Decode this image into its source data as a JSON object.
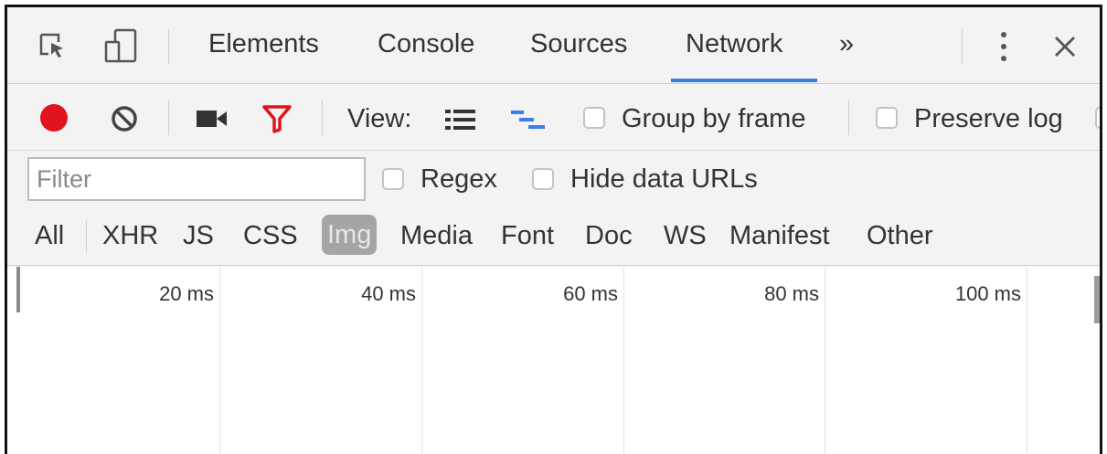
{
  "tabs": {
    "elements": "Elements",
    "console": "Console",
    "sources": "Sources",
    "network": "Network",
    "more": "»",
    "active": "Network"
  },
  "toolbar": {
    "view_label": "View:",
    "group_by_frame": "Group by frame",
    "preserve_log": "Preserve log",
    "record_color": "#e0141c",
    "filter_icon_color": "#e0141c",
    "waterfall_icon_color": "#3b7de9"
  },
  "filter": {
    "placeholder": "Filter",
    "value": "",
    "regex": "Regex",
    "hide_data_urls": "Hide data URLs"
  },
  "types": {
    "all": "All",
    "xhr": "XHR",
    "js": "JS",
    "css": "CSS",
    "img": "Img",
    "media": "Media",
    "font": "Font",
    "doc": "Doc",
    "ws": "WS",
    "manifest": "Manifest",
    "other": "Other",
    "active": "Img"
  },
  "timeline": {
    "ticks": [
      "20 ms",
      "40 ms",
      "60 ms",
      "80 ms",
      "100 ms"
    ]
  }
}
